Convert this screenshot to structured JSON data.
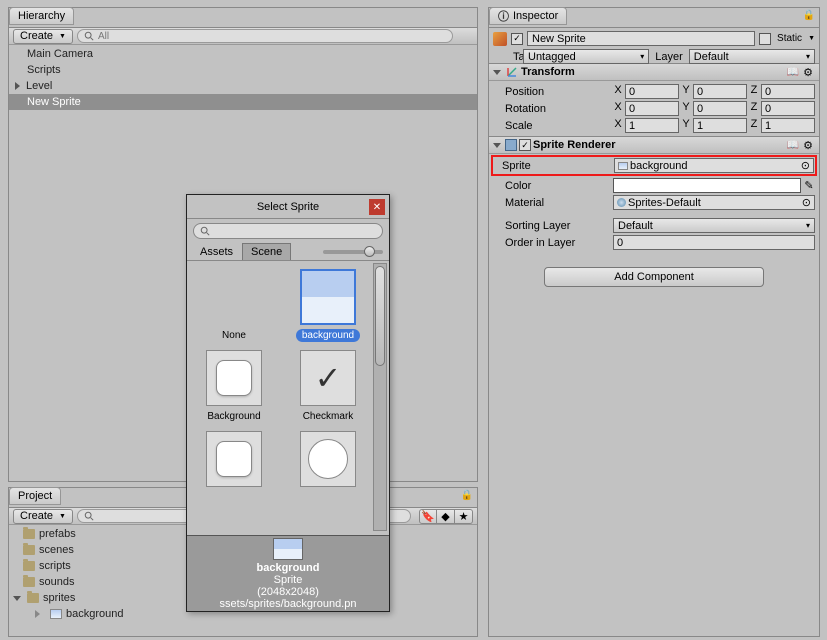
{
  "hierarchy": {
    "tab": "Hierarchy",
    "create": "Create",
    "search_prefix": "All",
    "items": [
      "Main Camera",
      "Scripts",
      "Level",
      "New Sprite"
    ],
    "selected_index": 3,
    "expandable_index": 2
  },
  "project": {
    "tab": "Project",
    "create": "Create",
    "folders": [
      "prefabs",
      "scenes",
      "scripts",
      "sounds",
      "sprites"
    ],
    "expanded_folder": "sprites",
    "child_item": "background"
  },
  "inspector": {
    "tab": "Inspector",
    "object_name": "New Sprite",
    "static_label": "Static",
    "tag_label": "Tag",
    "tag_value": "Untagged",
    "layer_label": "Layer",
    "layer_value": "Default",
    "transform": {
      "title": "Transform",
      "position_label": "Position",
      "rotation_label": "Rotation",
      "scale_label": "Scale",
      "position": {
        "x": "0",
        "y": "0",
        "z": "0"
      },
      "rotation": {
        "x": "0",
        "y": "0",
        "z": "0"
      },
      "scale": {
        "x": "1",
        "y": "1",
        "z": "1"
      }
    },
    "sprite_renderer": {
      "title": "Sprite Renderer",
      "sprite_label": "Sprite",
      "sprite_value": "background",
      "color_label": "Color",
      "material_label": "Material",
      "material_value": "Sprites-Default",
      "sorting_layer_label": "Sorting Layer",
      "sorting_layer_value": "Default",
      "order_label": "Order in Layer",
      "order_value": "0"
    },
    "add_component": "Add Component"
  },
  "popup": {
    "title": "Select Sprite",
    "tabs": [
      "Assets",
      "Scene"
    ],
    "active_tab": 1,
    "items": [
      {
        "label": "None",
        "kind": "none"
      },
      {
        "label": "background",
        "kind": "bg",
        "selected": true
      },
      {
        "label": "Background",
        "kind": "round"
      },
      {
        "label": "Checkmark",
        "kind": "check"
      },
      {
        "label": "",
        "kind": "round"
      },
      {
        "label": "",
        "kind": "circle"
      }
    ],
    "footer": {
      "name": "background",
      "type": "Sprite",
      "dims": "(2048x2048)",
      "path": "ssets/sprites/background.pn"
    }
  }
}
